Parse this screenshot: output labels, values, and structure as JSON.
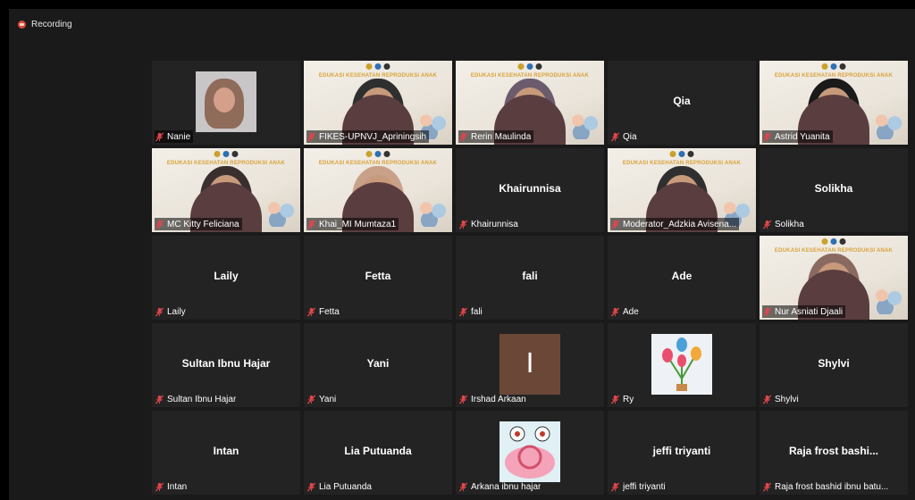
{
  "recording": {
    "label": "Recording",
    "color": "#d94a3a"
  },
  "participants": [
    {
      "name": "Nanie",
      "center_name": "",
      "kind": "photo"
    },
    {
      "name": "FIKES-UPNVJ_Apriningsih",
      "center_name": "",
      "kind": "video"
    },
    {
      "name": "Rerin Maulinda",
      "center_name": "",
      "kind": "video"
    },
    {
      "name": "Qia",
      "center_name": "Qia",
      "kind": "name"
    },
    {
      "name": "Astrid Yuanita",
      "center_name": "",
      "kind": "video",
      "active": true
    },
    {
      "name": "MC Kitty Feliciana",
      "center_name": "",
      "kind": "video"
    },
    {
      "name": "Khai_MI Mumtaza1",
      "center_name": "",
      "kind": "video"
    },
    {
      "name": "Khairunnisa",
      "center_name": "Khairunnisa",
      "kind": "name"
    },
    {
      "name": "Moderator_Adzkia Avisena...",
      "center_name": "",
      "kind": "video"
    },
    {
      "name": "Solikha",
      "center_name": "Solikha",
      "kind": "name"
    },
    {
      "name": "Laily",
      "center_name": "Laily",
      "kind": "name"
    },
    {
      "name": "Fetta",
      "center_name": "Fetta",
      "kind": "name"
    },
    {
      "name": "fali",
      "center_name": "fali",
      "kind": "name"
    },
    {
      "name": "Ade",
      "center_name": "Ade",
      "kind": "name"
    },
    {
      "name": "Nur Asniati Djaali",
      "center_name": "",
      "kind": "video"
    },
    {
      "name": "Sultan Ibnu Hajar",
      "center_name": "Sultan Ibnu Hajar",
      "kind": "name"
    },
    {
      "name": "Yani",
      "center_name": "Yani",
      "kind": "name"
    },
    {
      "name": "Irshad Arkaan",
      "center_name": "",
      "kind": "letter",
      "letter": "I"
    },
    {
      "name": "Ry",
      "center_name": "",
      "kind": "flower"
    },
    {
      "name": "Shylvi",
      "center_name": "Shylvi",
      "kind": "name"
    },
    {
      "name": "Intan",
      "center_name": "Intan",
      "kind": "name"
    },
    {
      "name": "Lia Putuanda",
      "center_name": "Lia Putuanda",
      "kind": "name"
    },
    {
      "name": "Arkana ibnu hajar",
      "center_name": "",
      "kind": "snail"
    },
    {
      "name": "jeffi triyanti",
      "center_name": "jeffi triyanti",
      "kind": "name"
    },
    {
      "name": "Raja frost bashid ibnu batu...",
      "center_name": "Raja frost bashi...",
      "kind": "name"
    }
  ],
  "banner_text": "EDUKASI KESEHATAN REPRODUKSI ANAK",
  "colors": {
    "active_speaker": "#9bd13c",
    "muted_icon": "#e0454b",
    "tile_bg": "#232323"
  },
  "icons": {
    "muted": "mic-off-icon"
  }
}
